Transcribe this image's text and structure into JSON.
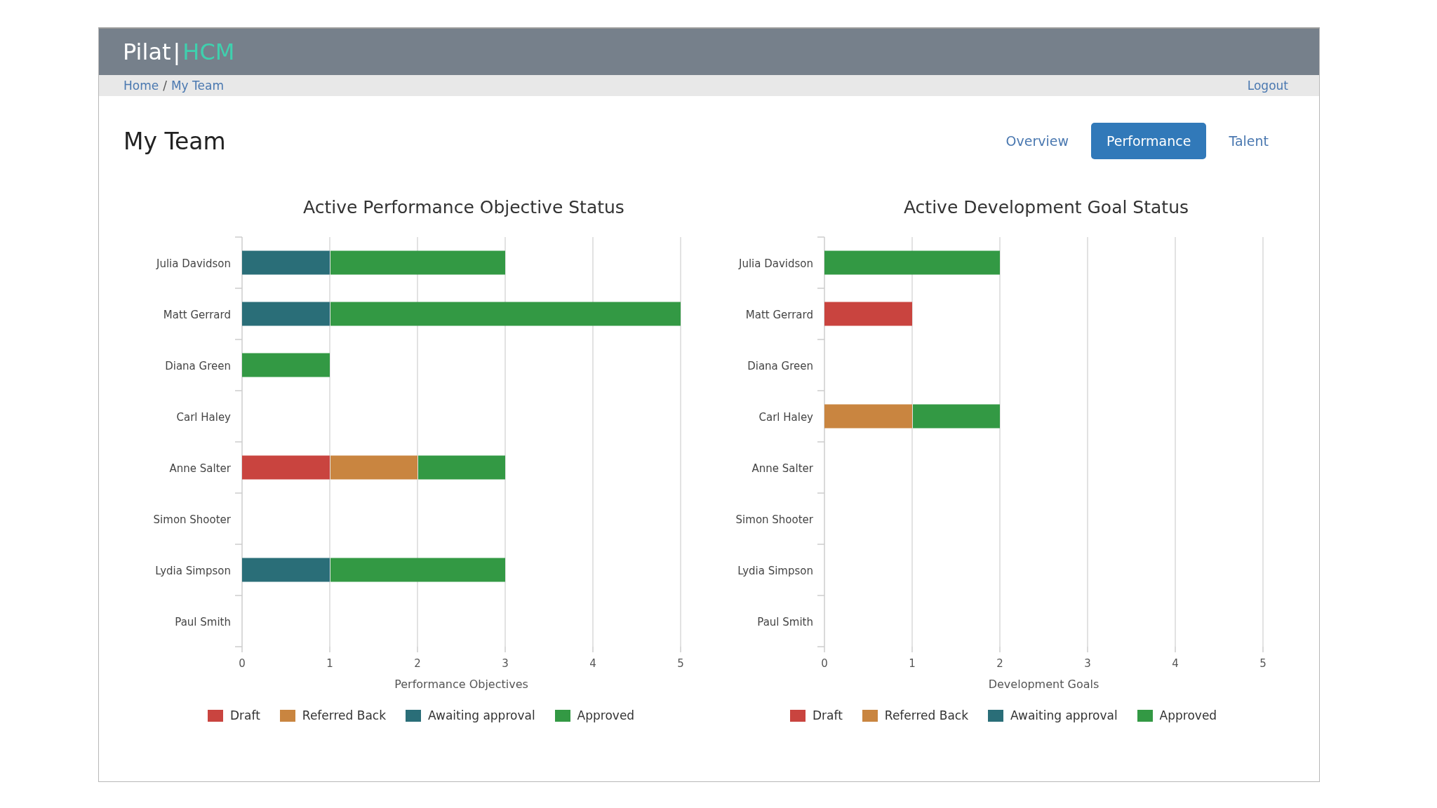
{
  "header": {
    "logo_main": "Pilat",
    "logo_sep": "|",
    "logo_accent": "HCM"
  },
  "breadcrumb": {
    "items": [
      "Home",
      "My Team"
    ],
    "separator": "/"
  },
  "logout": "Logout",
  "page_title": "My Team",
  "tabs": [
    {
      "label": "Overview",
      "selected": false
    },
    {
      "label": "Performance",
      "selected": true
    },
    {
      "label": "Talent",
      "selected": false
    }
  ],
  "charts": [
    {
      "chart_data": {
        "type": "bar",
        "orientation": "horizontal",
        "stacked": true,
        "grid": true,
        "title": "Active Performance Objective Status",
        "xlabel": "Performance Objectives",
        "categories": [
          "Julia Davidson",
          "Matt Gerrard",
          "Diana Green",
          "Carl Haley",
          "Anne Salter",
          "Simon Shooter",
          "Lydia Simpson",
          "Paul Smith"
        ],
        "xlim": [
          0,
          5
        ],
        "xticks": [
          0,
          1,
          2,
          3,
          4,
          5
        ],
        "series": [
          {
            "name": "Draft",
            "color": "#c9443f",
            "values": [
              0,
              0,
              0,
              0,
              1,
              0,
              0,
              0
            ]
          },
          {
            "name": "Referred Back",
            "color": "#c98540",
            "values": [
              0,
              0,
              0,
              0,
              1,
              0,
              0,
              0
            ]
          },
          {
            "name": "Awaiting approval",
            "color": "#2a6e78",
            "values": [
              1,
              1,
              0,
              0,
              0,
              0,
              1,
              0
            ]
          },
          {
            "name": "Approved",
            "color": "#339944",
            "values": [
              2,
              4,
              1,
              0,
              1,
              0,
              2,
              0
            ]
          }
        ]
      }
    },
    {
      "chart_data": {
        "type": "bar",
        "orientation": "horizontal",
        "stacked": true,
        "grid": true,
        "title": "Active Development Goal Status",
        "xlabel": "Development Goals",
        "categories": [
          "Julia Davidson",
          "Matt Gerrard",
          "Diana Green",
          "Carl Haley",
          "Anne Salter",
          "Simon Shooter",
          "Lydia Simpson",
          "Paul Smith"
        ],
        "xlim": [
          0,
          5
        ],
        "xticks": [
          0,
          1,
          2,
          3,
          4,
          5
        ],
        "series": [
          {
            "name": "Draft",
            "color": "#c9443f",
            "values": [
              0,
              1,
              0,
              0,
              0,
              0,
              0,
              0
            ]
          },
          {
            "name": "Referred Back",
            "color": "#c98540",
            "values": [
              0,
              0,
              0,
              1,
              0,
              0,
              0,
              0
            ]
          },
          {
            "name": "Awaiting approval",
            "color": "#2a6e78",
            "values": [
              0,
              0,
              0,
              0,
              0,
              0,
              0,
              0
            ]
          },
          {
            "name": "Approved",
            "color": "#339944",
            "values": [
              2,
              0,
              0,
              1,
              0,
              0,
              0,
              0
            ]
          }
        ]
      }
    }
  ]
}
